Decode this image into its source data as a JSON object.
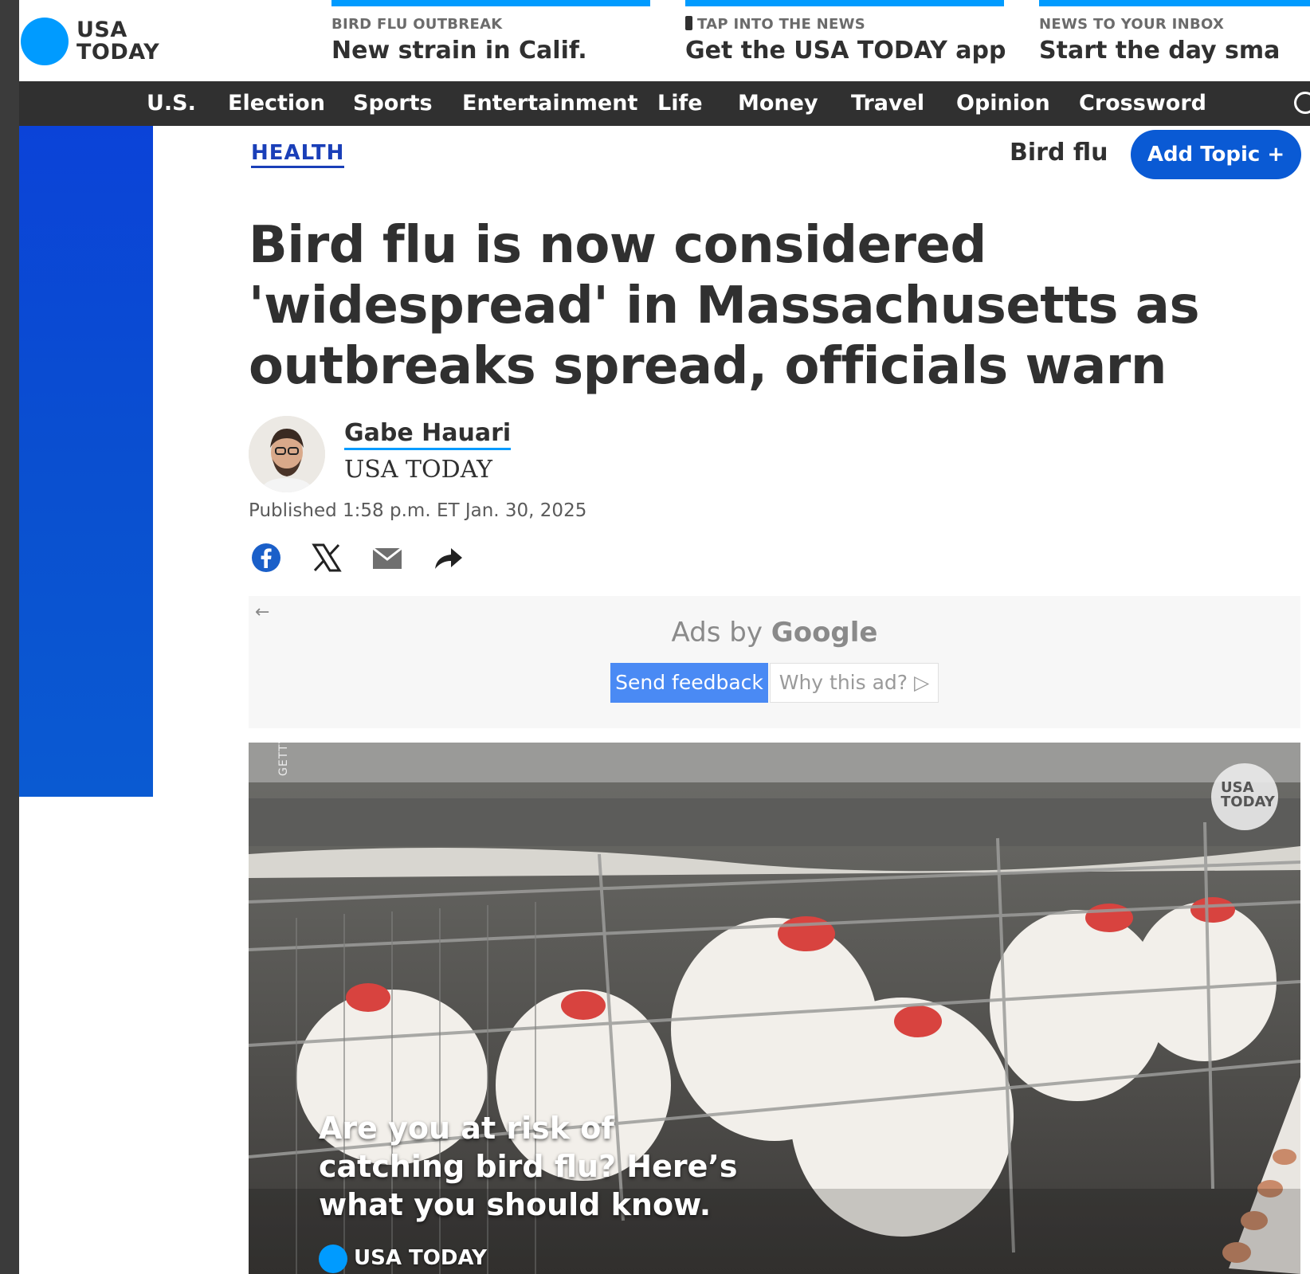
{
  "brand": {
    "logo_line1": "USA",
    "logo_line2": "TODAY",
    "color": "#009bff"
  },
  "promos": [
    {
      "kicker": "BIRD FLU OUTBREAK",
      "headline": "New strain in Calif."
    },
    {
      "kicker": "TAP INTO THE NEWS",
      "headline": "Get the USA TODAY app"
    },
    {
      "kicker": "NEWS TO YOUR INBOX",
      "headline": "Start the day sma"
    }
  ],
  "nav": {
    "items": [
      "U.S.",
      "Election",
      "Sports",
      "Entertainment",
      "Life",
      "Money",
      "Travel",
      "Opinion",
      "Crossword"
    ]
  },
  "article": {
    "section": "HEALTH",
    "topic_name": "Bird flu",
    "add_topic_label": "Add Topic +",
    "headline": "Bird flu is now considered 'widespread' in Massachusetts as outbreaks spread, officials warn",
    "author_name": "Gabe Hauari",
    "author_org": "USA TODAY",
    "published": "Published 1:58 p.m. ET Jan. 30, 2025"
  },
  "share": {
    "icons": [
      "facebook-icon",
      "x-icon",
      "email-icon",
      "share-arrow-icon"
    ]
  },
  "ad": {
    "back_arrow": "←",
    "ads_by_prefix": "Ads by ",
    "ads_by_brand": "Google",
    "send_feedback": "Send feedback",
    "why_this_ad": "Why this ad? ▷"
  },
  "video": {
    "credit": "GETTY",
    "caption_line1": "Are you at risk of",
    "caption_line2": "catching bird flu? Here’s",
    "caption_line3": "what you should know.",
    "brand": "USA TODAY",
    "bug_line1": "USA",
    "bug_line2": "TODAY"
  },
  "colors": {
    "nav_bg": "#303030",
    "accent_blue": "#0a5ad4",
    "topic_blue": "#1a3fb8"
  }
}
